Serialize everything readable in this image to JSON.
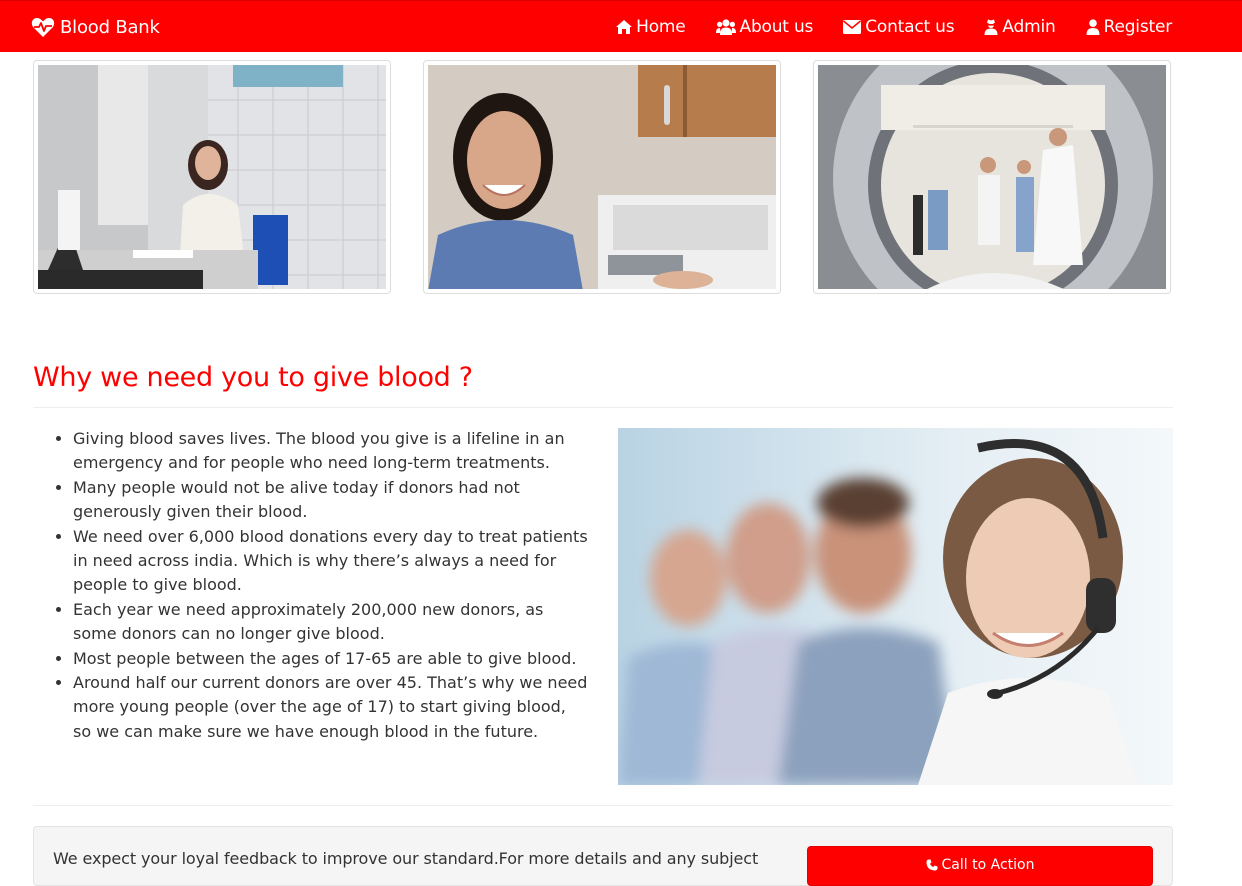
{
  "brand": {
    "name": "Blood Bank",
    "icon": "heartbeat-icon"
  },
  "nav": [
    {
      "label": "Home",
      "icon": "home-icon"
    },
    {
      "label": "About us",
      "icon": "users-icon"
    },
    {
      "label": "Contact us",
      "icon": "envelope-icon"
    },
    {
      "label": "Admin",
      "icon": "user-secret-icon"
    },
    {
      "label": "Register",
      "icon": "user-icon"
    }
  ],
  "section": {
    "title": "Why we need you to give blood ?",
    "reasons": [
      "Giving blood saves lives. The blood you give is a lifeline in an emergency and for people who need long-term treatments.",
      "Many people would not be alive today if donors had not generously given their blood.",
      "We need over 6,000 blood donations every day to treat patients in need across india. Which is why there’s always a need for people to give blood.",
      "Each year we need approximately 200,000 new donors, as some donors can no longer give blood.",
      "Most people between the ages of 17-65 are able to give blood.",
      "Around half our current donors are over 45. That’s why we need more young people (over the age of 17) to start giving blood, so we can make sure we have enough blood in the future."
    ]
  },
  "feedback": {
    "text": "We expect your loyal feedback to improve our standard.For more details and any subject",
    "cta_label": "Call to Action",
    "cta_icon": "phone-icon"
  },
  "colors": {
    "brand": "#ff0000",
    "text": "#333333",
    "well": "#f5f5f5"
  }
}
